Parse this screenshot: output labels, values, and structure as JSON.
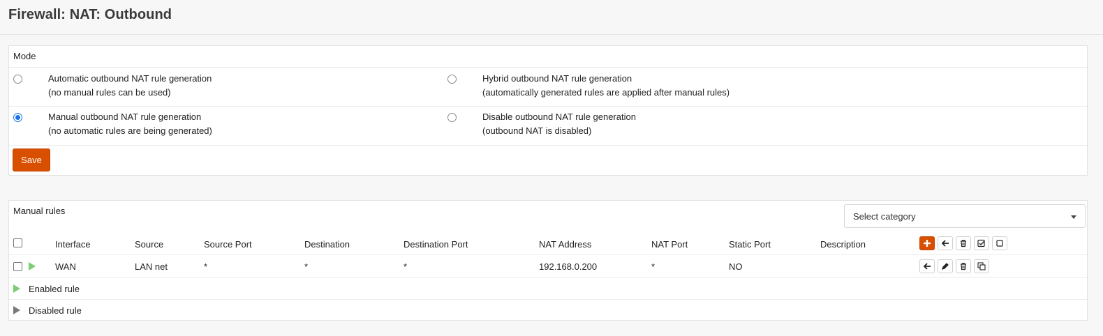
{
  "page": {
    "title": "Firewall: NAT: Outbound"
  },
  "mode": {
    "heading": "Mode",
    "options": [
      {
        "title": "Automatic outbound NAT rule generation",
        "desc": "(no manual rules can be used)",
        "checked": false
      },
      {
        "title": "Hybrid outbound NAT rule generation",
        "desc": "(automatically generated rules are applied after manual rules)",
        "checked": false
      },
      {
        "title": "Manual outbound NAT rule generation",
        "desc": "(no automatic rules are being generated)",
        "checked": true
      },
      {
        "title": "Disable outbound NAT rule generation",
        "desc": "(outbound NAT is disabled)",
        "checked": false
      }
    ],
    "save_label": "Save"
  },
  "rules": {
    "heading": "Manual rules",
    "category_select": "Select category",
    "columns": [
      "Interface",
      "Source",
      "Source Port",
      "Destination",
      "Destination Port",
      "NAT Address",
      "NAT Port",
      "Static Port",
      "Description"
    ],
    "rows": [
      {
        "interface": "WAN",
        "source": "LAN net",
        "source_port": "*",
        "destination": "*",
        "destination_port": "*",
        "nat_address": "192.168.0.200",
        "nat_port": "*",
        "static_port": "NO",
        "description": ""
      }
    ],
    "legend": [
      {
        "label": "Enabled rule",
        "icon": "play-icon-green"
      },
      {
        "label": "Disabled rule",
        "icon": "play-icon-grey"
      }
    ]
  },
  "colors": {
    "accent": "#d94f00",
    "enabled": "#7dcb73",
    "disabled": "#7a7a7a",
    "radio": "#1a73e8"
  }
}
